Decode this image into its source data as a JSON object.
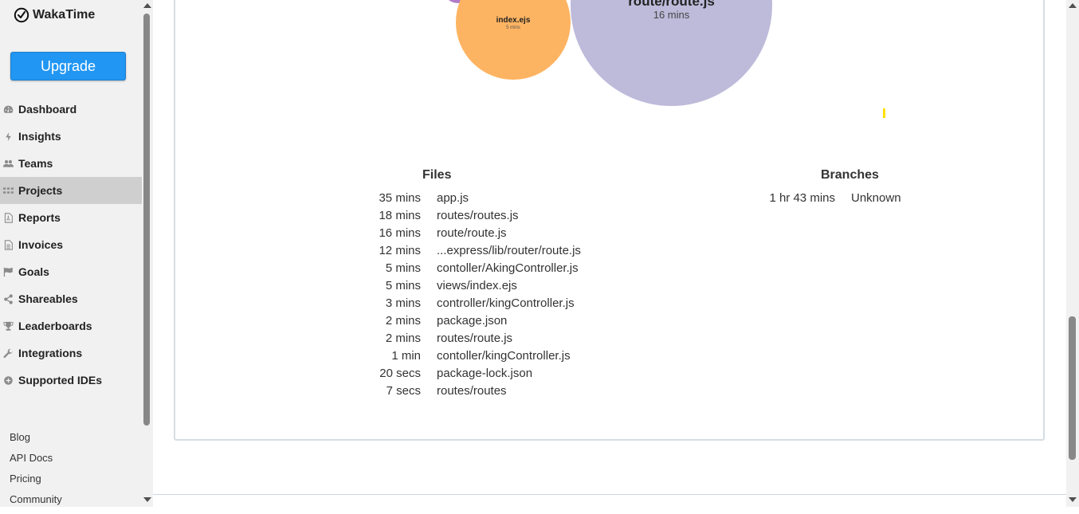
{
  "app": {
    "name": "WakaTime"
  },
  "colors": {
    "accent": "#2196f3",
    "sidebar_bg": "#f1f1f1",
    "active_item_bg": "#cfcfcf",
    "bubble_orange": "#fdb462",
    "bubble_lavender": "#bebada",
    "bubble_purple": "#b07bc8",
    "marker_yellow": "#ffe000"
  },
  "sidebar": {
    "upgrade_label": "Upgrade",
    "items": [
      {
        "label": "Dashboard",
        "icon": "dashboard-icon"
      },
      {
        "label": "Insights",
        "icon": "bolt-icon"
      },
      {
        "label": "Teams",
        "icon": "users-icon"
      },
      {
        "label": "Projects",
        "icon": "grid-icon",
        "active": true
      },
      {
        "label": "Reports",
        "icon": "pdf-file-icon"
      },
      {
        "label": "Invoices",
        "icon": "file-text-icon"
      },
      {
        "label": "Goals",
        "icon": "flag-icon"
      },
      {
        "label": "Shareables",
        "icon": "share-icon"
      },
      {
        "label": "Leaderboards",
        "icon": "trophy-icon"
      },
      {
        "label": "Integrations",
        "icon": "wrench-icon"
      },
      {
        "label": "Supported IDEs",
        "icon": "plus-circle-icon"
      }
    ],
    "footer_links": [
      "Blog",
      "API Docs",
      "Pricing",
      "Community"
    ]
  },
  "bubbles": {
    "orange": {
      "name": "index.ejs",
      "duration": "5 mins"
    },
    "lavender": {
      "name": "route/route.js",
      "duration": "16 mins"
    }
  },
  "files": {
    "title": "Files",
    "rows": [
      {
        "duration": "35 mins",
        "name": "app.js"
      },
      {
        "duration": "18 mins",
        "name": "routes/routes.js"
      },
      {
        "duration": "16 mins",
        "name": "route/route.js"
      },
      {
        "duration": "12 mins",
        "name": "...express/lib/router/route.js"
      },
      {
        "duration": "5 mins",
        "name": "contoller/AkingController.js"
      },
      {
        "duration": "5 mins",
        "name": "views/index.ejs"
      },
      {
        "duration": "3 mins",
        "name": "controller/kingController.js"
      },
      {
        "duration": "2 mins",
        "name": "package.json"
      },
      {
        "duration": "2 mins",
        "name": "routes/route.js"
      },
      {
        "duration": "1 min",
        "name": "contoller/kingController.js"
      },
      {
        "duration": "20 secs",
        "name": "package-lock.json"
      },
      {
        "duration": "7 secs",
        "name": "routes/routes"
      }
    ]
  },
  "branches": {
    "title": "Branches",
    "rows": [
      {
        "duration": "1 hr 43 mins",
        "name": "Unknown"
      }
    ]
  }
}
